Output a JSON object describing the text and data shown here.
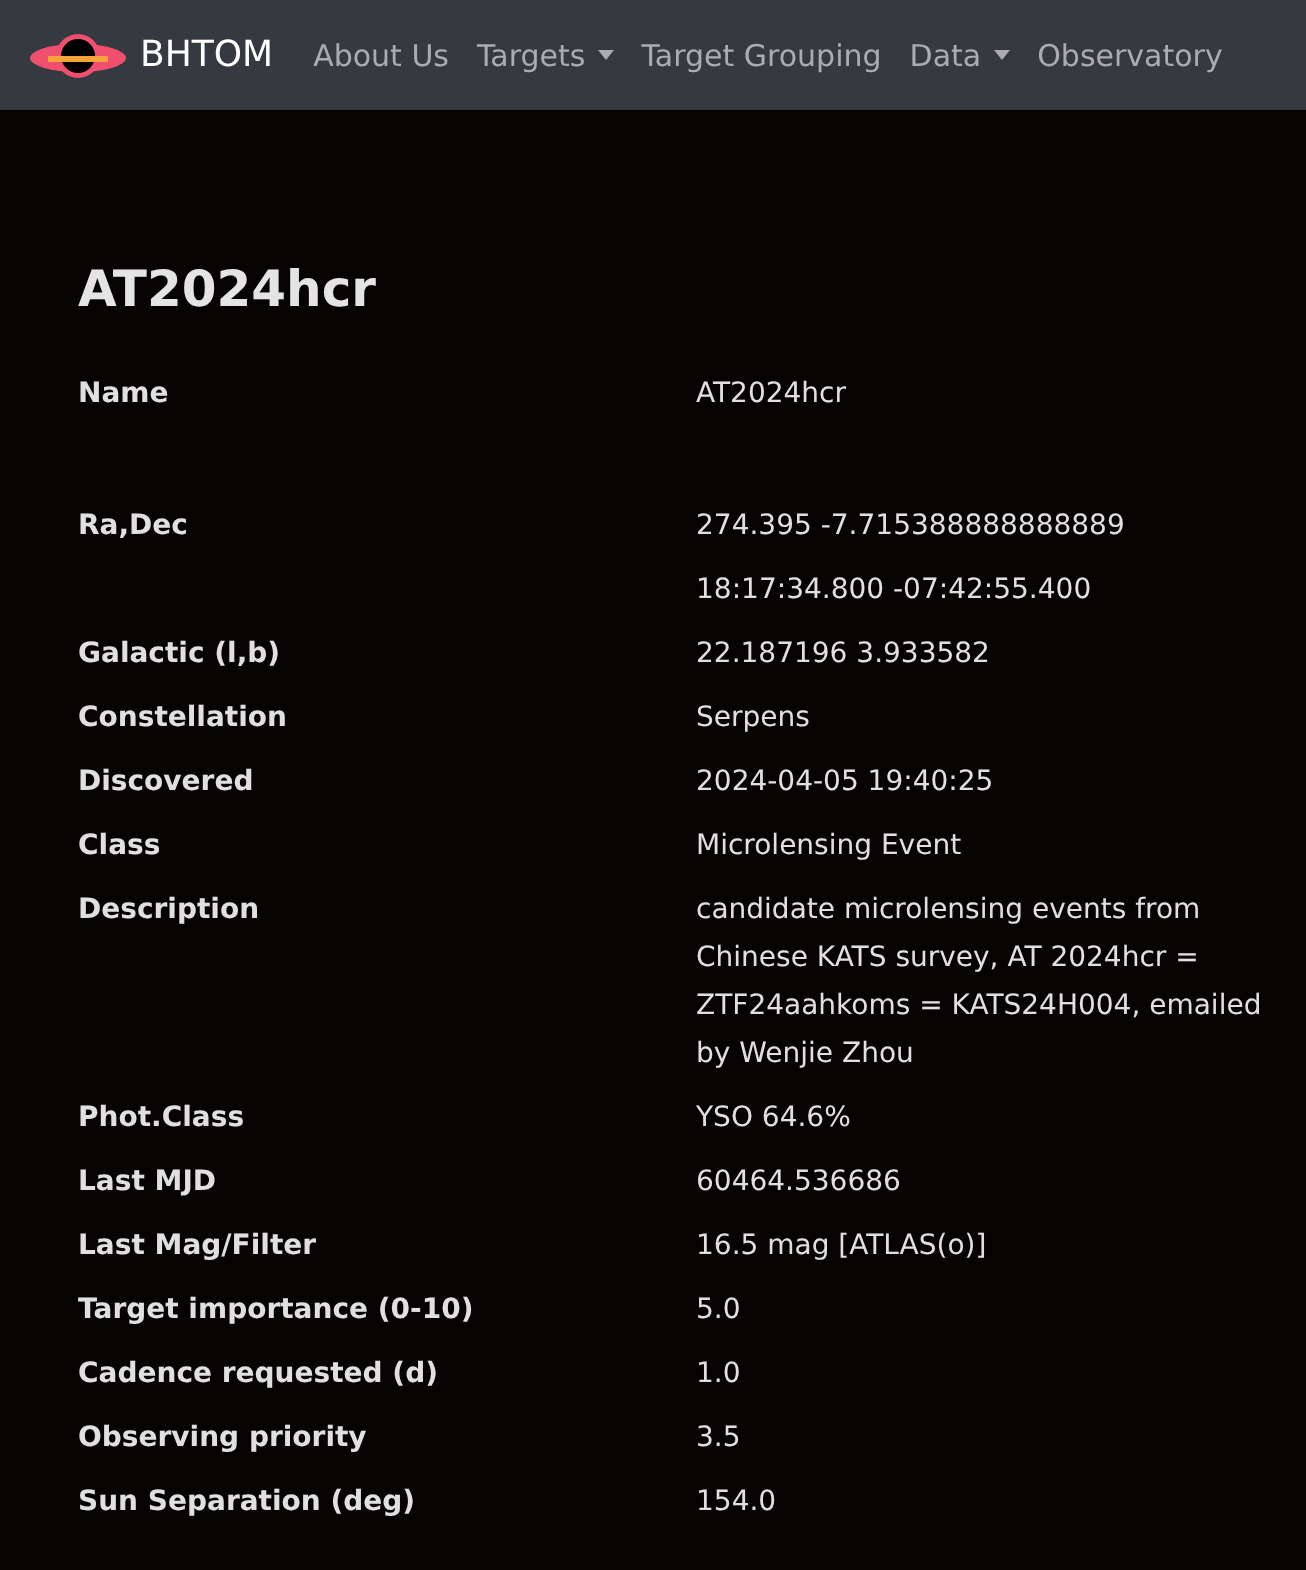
{
  "navbar": {
    "brand": "BHTOM",
    "links": [
      {
        "label": "About Us",
        "dropdown": false
      },
      {
        "label": "Targets",
        "dropdown": true
      },
      {
        "label": "Target Grouping",
        "dropdown": false
      },
      {
        "label": "Data",
        "dropdown": true
      },
      {
        "label": "Observatory",
        "dropdown": false
      }
    ]
  },
  "title": "AT2024hcr",
  "fields": [
    {
      "kind": "name",
      "label": "Name",
      "values": [
        "AT2024hcr"
      ]
    },
    {
      "kind": "field",
      "label": "Ra,Dec",
      "values": [
        "274.395 -7.715388888888889",
        "18:17:34.800 -07:42:55.400"
      ]
    },
    {
      "kind": "field",
      "label": "Galactic (l,b)",
      "values": [
        "22.187196 3.933582"
      ]
    },
    {
      "kind": "field",
      "label": "Constellation",
      "values": [
        "Serpens"
      ]
    },
    {
      "kind": "field",
      "label": "Discovered",
      "values": [
        "2024-04-05 19:40:25"
      ]
    },
    {
      "kind": "field",
      "label": "Class",
      "values": [
        "Microlensing Event"
      ]
    },
    {
      "kind": "field",
      "label": "Description",
      "values": [
        "candidate microlensing events from Chinese KATS survey, AT 2024hcr = ZTF24aahkoms = KATS24H004, emailed by Wenjie Zhou"
      ]
    },
    {
      "kind": "field",
      "label": "Phot.Class",
      "values": [
        "YSO 64.6%"
      ]
    },
    {
      "kind": "field",
      "label": "Last MJD",
      "values": [
        "60464.536686"
      ]
    },
    {
      "kind": "field",
      "label": "Last Mag/Filter",
      "values": [
        "16.5 mag [ATLAS(o)]"
      ]
    },
    {
      "kind": "field",
      "label": "Target importance (0-10)",
      "values": [
        "5.0"
      ]
    },
    {
      "kind": "field",
      "label": "Cadence requested (d)",
      "values": [
        "1.0"
      ]
    },
    {
      "kind": "field",
      "label": "Observing priority",
      "values": [
        "3.5"
      ]
    },
    {
      "kind": "field",
      "label": "Sun Separation (deg)",
      "values": [
        "154.0"
      ]
    }
  ]
}
